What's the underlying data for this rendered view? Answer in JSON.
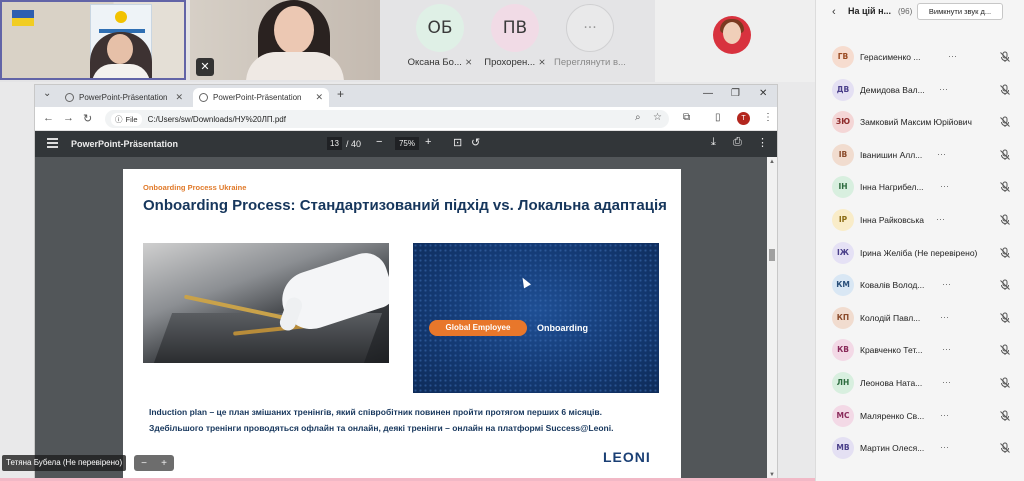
{
  "video_strip": {
    "tiles": [
      {
        "initials": "ОБ",
        "name": "Оксана Бо...",
        "color": "#dff0e6"
      },
      {
        "initials": "ПВ",
        "name": "Прохорен...",
        "color": "#f1dbe6"
      }
    ],
    "more": {
      "label": "Переглянути в...",
      "icon": "ellipsis-icon"
    }
  },
  "browser": {
    "tabs": [
      {
        "title": "PowerPoint-Präsentation",
        "active": false
      },
      {
        "title": "PowerPoint-Präsentation",
        "active": true
      }
    ],
    "address": {
      "chip": "File",
      "url": "C:/Users/sw/Downloads/НУ%20ЛП.pdf"
    },
    "profile_initial": "Т"
  },
  "pdf": {
    "title": "PowerPoint-Präsentation",
    "page": "13",
    "page_total": "/ 40",
    "zoom": "75%"
  },
  "slide": {
    "kicker": "Onboarding Process Ukraine",
    "heading": "Onboarding Process: Стандартизований підхід vs. Локальна адаптація",
    "pill": "Global Employee",
    "onboarding": "Onboarding",
    "body1": "Induction plan – це план змішаних тренінгів, який співробітник повинен пройти протягом перших 6 місяців.",
    "body2": "Здебільшого тренінги проводяться офлайн та онлайн, деякі тренінги – онлайн на платформі Success@Leoni.",
    "logo": "LEONI"
  },
  "share_overlay": {
    "name_badge": "Тетяна Бубела (Не перевірено)",
    "zoom_minus": "−",
    "zoom_plus": "+"
  },
  "panel": {
    "title": "На цій н...",
    "count": "(96)",
    "mute_all": "Вимкнути звук д...",
    "participants": [
      {
        "initials": "ГВ",
        "name": "Герасименко ...",
        "more": "···",
        "bg": "#f6dccf",
        "fg": "#9a4a22"
      },
      {
        "initials": "ДВ",
        "name": "Демидова Вал...",
        "more": "···",
        "bg": "#e4e0f3",
        "fg": "#4a3f8a"
      },
      {
        "initials": "ЗЮ",
        "name": "Замковий Максим Юрійович",
        "more": "",
        "bg": "#f4d6d6",
        "fg": "#8e2a2a"
      },
      {
        "initials": "ІВ",
        "name": "Іванишин Алл...",
        "more": "···",
        "bg": "#f1dccf",
        "fg": "#8a4a2a"
      },
      {
        "initials": "ІН",
        "name": "Інна Нагрибел...",
        "more": "···",
        "bg": "#d8efdf",
        "fg": "#2c6b3e"
      },
      {
        "initials": "ІР",
        "name": "Інна Райковська",
        "more": "···",
        "bg": "#f9ecc8",
        "fg": "#8a6a12"
      },
      {
        "initials": "ІЖ",
        "name": "Ірина Желіба (Не перевірено)",
        "more": "",
        "bg": "#e5e1f5",
        "fg": "#4a3f8a"
      },
      {
        "initials": "КМ",
        "name": "Ковалів Волод...",
        "more": "···",
        "bg": "#d9e7f4",
        "fg": "#2a4f7a"
      },
      {
        "initials": "КП",
        "name": "Колодій Павл...",
        "more": "···",
        "bg": "#f1dccf",
        "fg": "#8a4a2a"
      },
      {
        "initials": "КВ",
        "name": "Кравченко Тет...",
        "more": "···",
        "bg": "#f3d9e6",
        "fg": "#8a2a5a"
      },
      {
        "initials": "ЛН",
        "name": "Леонова Ната...",
        "more": "···",
        "bg": "#d8efdf",
        "fg": "#2c6b3e"
      },
      {
        "initials": "МС",
        "name": "Маляренко Св...",
        "more": "···",
        "bg": "#f3d9e6",
        "fg": "#8a2a5a"
      },
      {
        "initials": "МВ",
        "name": "Мартин Олеся...",
        "more": "···",
        "bg": "#e4e0f3",
        "fg": "#4a3f8a"
      }
    ]
  }
}
